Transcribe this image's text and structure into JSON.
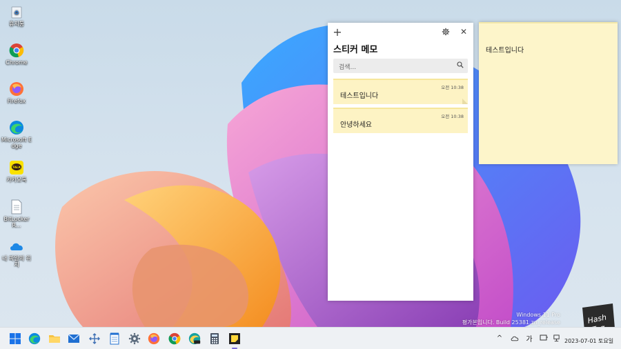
{
  "desktop": {
    "icons": [
      {
        "label": "휴지통",
        "icon": "recycle-bin-icon"
      },
      {
        "label": "Chrome",
        "icon": "chrome-icon"
      },
      {
        "label": "Firefox",
        "icon": "firefox-icon"
      },
      {
        "label": "Microsoft Edge",
        "icon": "edge-icon"
      },
      {
        "label": "카카오톡",
        "icon": "kakaotalk-icon"
      },
      {
        "label": "BitLockerR...",
        "icon": "document-icon"
      },
      {
        "label": "내 파일의 위치",
        "icon": "onedrive-icon"
      }
    ]
  },
  "notes_list": {
    "title": "스티커 메모",
    "add_glyph": "+",
    "close_glyph": "✕",
    "search_placeholder": "검색...",
    "notes": [
      {
        "time": "오전 10:38",
        "text": "테스트입니다"
      },
      {
        "time": "오전 10:38",
        "text": "안녕하세요"
      }
    ]
  },
  "open_note": {
    "text": "테스트입니다"
  },
  "watermark": {
    "line1": "Windows 11 Pro",
    "line2": "평가본입니다. Build 25381.zn_release"
  },
  "logo": {
    "line1": "Hash",
    "line2": "Tag"
  },
  "taskbar": {
    "apps": [
      "start-icon",
      "edge-icon",
      "file-explorer-icon",
      "mail-icon",
      "move-icon",
      "notepad-icon",
      "settings-icon",
      "firefox-icon",
      "chrome-icon",
      "edge-canary-icon",
      "calculator-icon",
      "sticky-notes-icon"
    ],
    "tray": {
      "chevron": "^",
      "ime": "가"
    },
    "date": "2023-07-01 토요일"
  },
  "colors": {
    "note_yellow": "#fdf3c4",
    "accent": "#7a6cd8"
  }
}
